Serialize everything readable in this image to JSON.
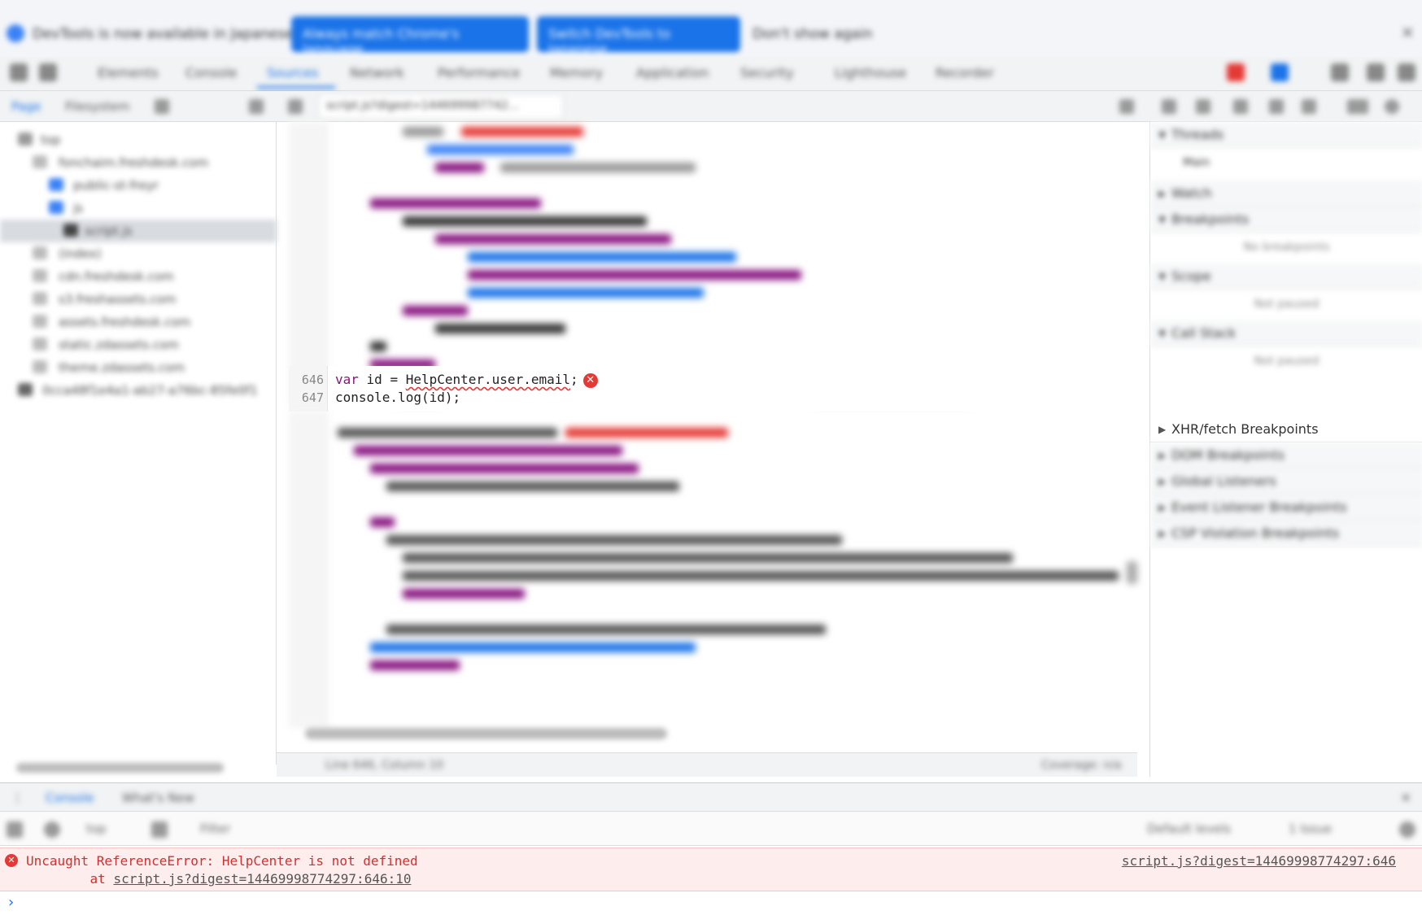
{
  "infobar": {
    "message": "DevTools is now available in Japanese",
    "button_primary": "Always match Chrome's language",
    "button_secondary": "Switch DevTools to Japanese",
    "dismiss": "Don't show again",
    "close_icon": "close-icon"
  },
  "main_tabs": [
    {
      "label": "Elements"
    },
    {
      "label": "Console"
    },
    {
      "label": "Sources",
      "active": true
    },
    {
      "label": "Network"
    },
    {
      "label": "Performance"
    },
    {
      "label": "Memory"
    },
    {
      "label": "Application"
    },
    {
      "label": "Security"
    },
    {
      "label": "Lighthouse"
    },
    {
      "label": "Recorder"
    }
  ],
  "sources_bar": {
    "page_tab": "Page",
    "filesystem_tab": "Filesystem",
    "file_tab": "script.js?digest=144699987742..."
  },
  "navigator": {
    "items": [
      {
        "label": "top"
      },
      {
        "label": "fonchaim.freshdesk.com"
      },
      {
        "label": "public-st-freyr"
      },
      {
        "label": "js"
      },
      {
        "label": "script.js"
      },
      {
        "label": "(index)"
      },
      {
        "label": "cdn.freshdesk.com"
      },
      {
        "label": "s3.freshassets.com"
      },
      {
        "label": "assets.freshdesk.com"
      },
      {
        "label": "static.zdassets.com"
      },
      {
        "label": "theme.zdassets.com"
      },
      {
        "label": "0cca48f1e4a1-ab27-a76bc-85fe0f1"
      }
    ]
  },
  "editor": {
    "lines": [
      {
        "num": "646",
        "pre": "var",
        "mid": " id = ",
        "obj": "HelpCenter.user.email",
        "post": ";"
      },
      {
        "num": "647",
        "text": "console.log(id);"
      }
    ],
    "status_left": "Line 646, Column 10",
    "status_right": "Coverage: n/a"
  },
  "debugger": {
    "sections": [
      {
        "label": "Threads"
      },
      {
        "label": "Main"
      },
      {
        "label": "Watch"
      },
      {
        "label": "Breakpoints"
      },
      {
        "label": "Scope"
      },
      {
        "label": "Call Stack"
      },
      {
        "label": "XHR/fetch Breakpoints"
      },
      {
        "label": "DOM Breakpoints"
      },
      {
        "label": "Global Listeners"
      },
      {
        "label": "Event Listener Breakpoints"
      },
      {
        "label": "CSP Violation Breakpoints"
      }
    ],
    "empty_breakpoints": "No breakpoints",
    "not_paused": "Not paused"
  },
  "drawer": {
    "tabs": [
      {
        "label": "Console"
      },
      {
        "label": "What's New"
      }
    ],
    "context": "top",
    "filter_placeholder": "Filter",
    "levels": "Default levels",
    "issues": "1 Issue"
  },
  "console": {
    "error_message": "Uncaught ReferenceError: HelpCenter is not defined",
    "at_prefix": "    at ",
    "at_link": "script.js?digest=14469998774297:646:10",
    "source_link": "script.js?digest=14469998774297:646",
    "prompt_icon": "chevron-right-icon"
  },
  "colors": {
    "accent": "#1a73e8",
    "error": "#d32f2f",
    "error_bg": "#fdeeed"
  }
}
